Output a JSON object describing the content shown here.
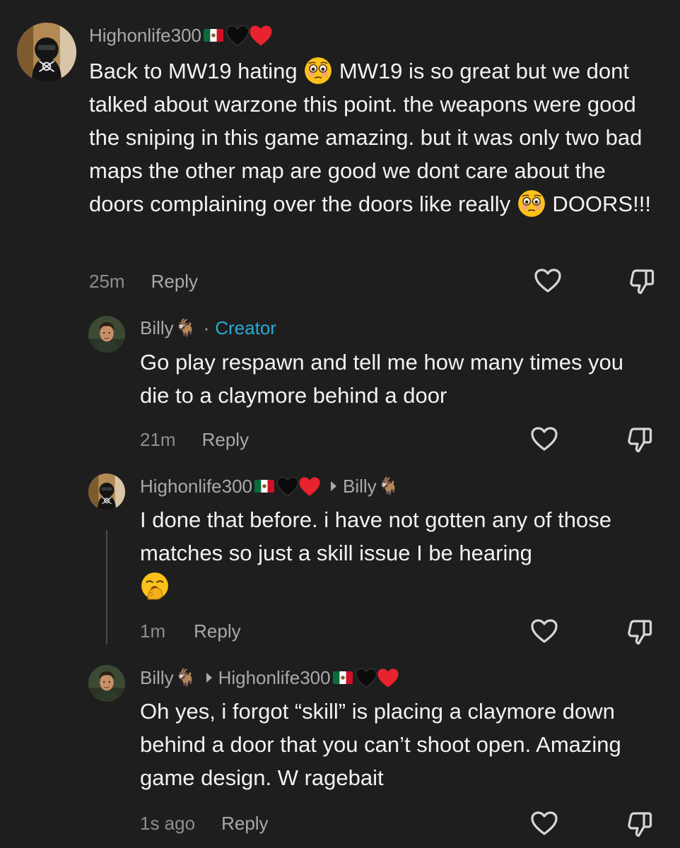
{
  "comments": [
    {
      "username": "Highonlife300",
      "text_parts": [
        "Back to MW19 hating ",
        " MW19 is so great but we dont talked about warzone this point. the weapons were good the sniping in this game amazing. but it was only two bad maps the other map are good we dont care about the doors complaining over the doors like really ",
        " DOORS!!!"
      ],
      "emoji": "flushed-face",
      "time": "25m",
      "reply_label": "Reply"
    },
    {
      "username": "Billy",
      "creator_label": "Creator",
      "text": "Go play respawn and tell me how many times you die to a claymore behind a door",
      "time": "21m",
      "reply_label": "Reply"
    },
    {
      "username": "Highonlife300",
      "reply_to": "Billy",
      "text": "I done that before. i have not gotten any of those matches so just a skill issue I be hearing",
      "emoji": "yawning-face",
      "time": "1m",
      "reply_label": "Reply"
    },
    {
      "username": "Billy",
      "reply_to": "Highonlife300",
      "text": "Oh yes, i forgot “skill” is placing a claymore down behind a door that you can’t shoot open. Amazing game design. W ragebait",
      "time": "1s ago",
      "reply_label": "Reply"
    }
  ],
  "icons": {
    "like": "heart-outline-icon",
    "dislike": "thumbs-down-icon",
    "flag": "mexico-flag-icon",
    "goat": "goat-emoji"
  },
  "colors": {
    "background": "#1e1e1e",
    "creator": "#2aa9d2",
    "muted": "#a9a9a9"
  }
}
